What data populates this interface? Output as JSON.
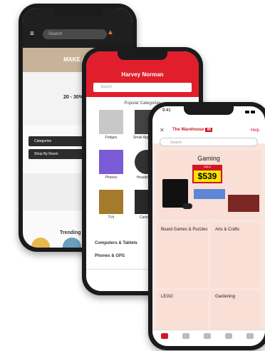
{
  "phone1": {
    "search_placeholder": "Search",
    "banner_text": "MAKE A ...",
    "promo_text": "20 - 30% Off",
    "categories": [
      "Categories",
      "Shop By Room"
    ],
    "trending_label": "Trending",
    "colors": {
      "header": "#1f1f1f",
      "accent": "#ef6b2d"
    }
  },
  "phone2": {
    "logo_text": "Harvey Norman",
    "search_placeholder": "Search",
    "section_title": "Popular Categories",
    "tiles": [
      "Fridges",
      "Small Appliances",
      "Phones",
      "Headphones",
      "TVs",
      "Cameras"
    ],
    "row1": "Computers & Tablets",
    "row2": "Phones & GPS",
    "colors": {
      "header": "#e11e2b"
    }
  },
  "phone3": {
    "time": "9:41",
    "logo_text": "The Warehouse",
    "logo_badge": "W",
    "help_text": "Help",
    "search_placeholder": "Search",
    "gaming_title": "Gaming",
    "sale_label": "SALE",
    "price": "$539",
    "cards": [
      {
        "title": "Board Games & Puzzles"
      },
      {
        "title": "Arts & Crafts"
      },
      {
        "title": "LEGO"
      },
      {
        "title": "Gardening"
      }
    ],
    "tab_icons": [
      "home-icon",
      "categories-icon",
      "cart-icon",
      "search-icon",
      "account-icon"
    ],
    "colors": {
      "brand": "#d01823",
      "price_bg": "#fbe500",
      "bg": "#f8e5dd"
    }
  }
}
